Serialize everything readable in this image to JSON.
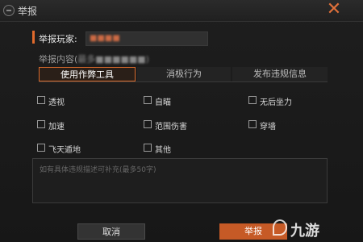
{
  "window": {
    "title": "举报",
    "close_icon": "close-icon",
    "accent": "#e06a2c"
  },
  "form": {
    "player_label": "举报玩家:",
    "player_value": "■■■■",
    "content_label": "举报内容(",
    "content_value": "最多■■■■■■)",
    "tabs": [
      {
        "label": "使用作弊工具",
        "active": true
      },
      {
        "label": "消极行为",
        "active": false
      },
      {
        "label": "发布违规信息",
        "active": false
      }
    ],
    "options": [
      "透视",
      "自瞄",
      "无后坐力",
      "加速",
      "范围伤害",
      "穿墙",
      "飞天遁地",
      "其他"
    ],
    "note_placeholder": "如有具体违规描述可补充(最多50字)"
  },
  "buttons": {
    "cancel": "取消",
    "submit": "举报"
  },
  "watermark": {
    "text": "九游"
  }
}
